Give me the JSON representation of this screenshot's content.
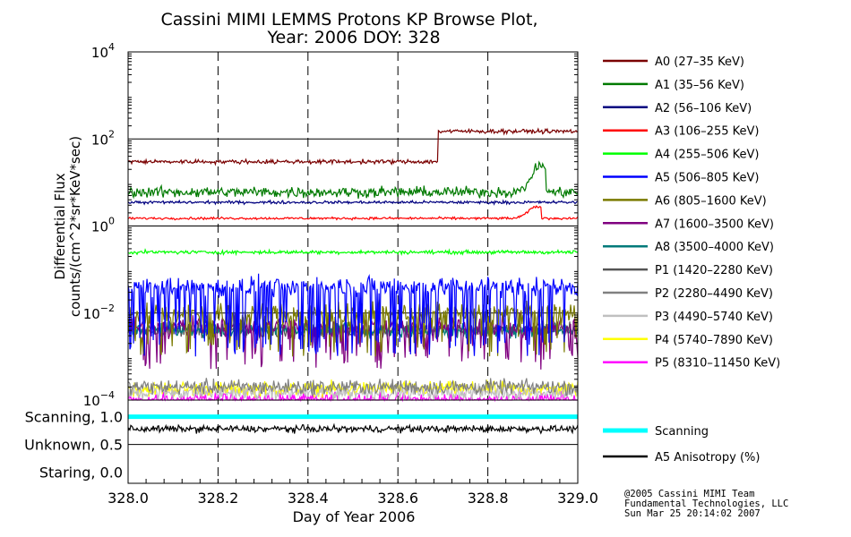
{
  "chart_data": {
    "type": "line",
    "title_line1": "Cassini MIMI LEMMS Protons KP Browse Plot,",
    "title_line2": "Year: 2006 DOY: 328",
    "xlabel": "Day of Year 2006",
    "ylabel_line1": "Differential Flux",
    "ylabel_line2": "counts/(cm^2*sr*KeV*sec)",
    "x_range": [
      328.0,
      329.0
    ],
    "x_ticks": [
      "328.0",
      "328.2",
      "328.4",
      "328.6",
      "328.8",
      "329.0"
    ],
    "y_scale": "log",
    "y_range": [
      0.0001,
      10000
    ],
    "y_ticks": [
      {
        "base": "10",
        "exp": "4",
        "value": 10000
      },
      {
        "base": "10",
        "exp": "2",
        "value": 100
      },
      {
        "base": "10",
        "exp": "0",
        "value": 1
      },
      {
        "base": "10",
        "exp": "−2",
        "value": 0.01
      },
      {
        "base": "10",
        "exp": "−4",
        "value": 0.0001
      }
    ],
    "grid": true,
    "legend_position": "right",
    "series": [
      {
        "name": "A0 (27–35 KeV)",
        "color": "#7a0000",
        "level_before": 30,
        "level_after": 150,
        "step_at": 328.69
      },
      {
        "name": "A1 (35–56 KeV)",
        "color": "#007a00",
        "level": 6,
        "bump_at": 328.92,
        "bump_peak": 25
      },
      {
        "name": "A2 (56–106 KeV)",
        "color": "#000080",
        "level": 3.5
      },
      {
        "name": "A3 (106–255 KeV)",
        "color": "#ff0000",
        "level": 1.5,
        "bump_at": 328.91,
        "bump_peak": 2.8
      },
      {
        "name": "A4 (255–506 KeV)",
        "color": "#00ff00",
        "level": 0.25
      },
      {
        "name": "A5 (506–805 KeV)",
        "color": "#0000ff",
        "level": 0.04,
        "dropouts_to": 0.001
      },
      {
        "name": "A6 (805–1600 KeV)",
        "color": "#7a7a00",
        "level": 0.01,
        "dropouts_to": 0.001
      },
      {
        "name": "A7 (1600–3500 KeV)",
        "color": "#800080",
        "level": 0.005,
        "dropouts_to": 0.0005
      },
      {
        "name": "A8 (3500–4000 KeV)",
        "color": "#007a7a",
        "level": 0.004
      },
      {
        "name": "P1 (1420–2280 KeV)",
        "color": "#555555",
        "level": 0.004
      },
      {
        "name": "P2 (2280–4490 KeV)",
        "color": "#808080",
        "level": 0.0002
      },
      {
        "name": "P3 (4490–5740 KeV)",
        "color": "#c0c0c0",
        "level": 0.00015
      },
      {
        "name": "P4 (5740–7890 KeV)",
        "color": "#ffff00",
        "level": 0.00018
      },
      {
        "name": "P5 (8310–11450 KeV)",
        "color": "#ff00ff",
        "level": 0.0001
      }
    ],
    "lower_panel": {
      "y_labels": [
        "Scanning, 1.0",
        "Unknown, 0.5",
        "Staring, 0.0"
      ],
      "y_values": [
        1.0,
        0.5,
        0.0
      ],
      "series": [
        {
          "name": "Scanning",
          "color": "#00ffff",
          "value": 1.0
        },
        {
          "name": "A5 Anisotropy (%)",
          "color": "#000000",
          "mean": 0.78,
          "spread": 0.09
        }
      ]
    }
  },
  "footer": {
    "line1": "@2005 Cassini MIMI Team",
    "line2": "Fundamental Technologies, LLC",
    "line3": "Sun Mar 25 20:14:02 2007"
  }
}
